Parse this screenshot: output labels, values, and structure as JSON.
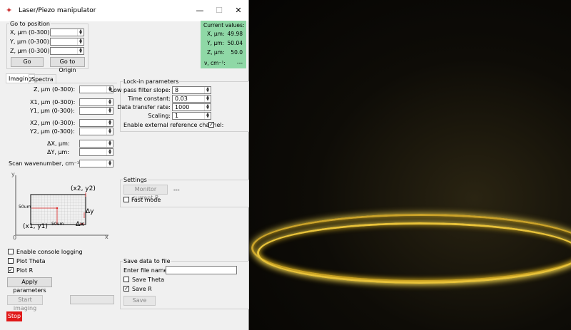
{
  "window": {
    "title": "Laser/Piezo manipulator",
    "min": "—",
    "max": "☐",
    "close": "✕"
  },
  "goto": {
    "title": "Go to position",
    "x_label": "X, µm (0-300):",
    "y_label": "Y, µm (0-300):",
    "z_label": "Z, µm (0-300):",
    "go": "Go",
    "origin": "Go to Origin"
  },
  "current": {
    "title": "Current values:",
    "x_label": "X, µm:",
    "x_val": "49.98",
    "y_label": "Y, µm:",
    "y_val": "50.04",
    "z_label": "Z, µm:",
    "z_val": "50.0",
    "v_label": "ν, cm⁻¹:",
    "v_val": "---"
  },
  "tabs": {
    "imaging": "Imaging",
    "spectra": "Spectra"
  },
  "imaging": {
    "z": "Z, µm (0-300):",
    "x1": "X1, µm (0-300):",
    "y1": "Y1, µm (0-300):",
    "x2": "X2, µm (0-300):",
    "y2": "Y2, µm (0-300):",
    "dx": "ΔX, µm:",
    "dy": "ΔY, µm:",
    "scan": "Scan wavenumber, cm⁻¹:"
  },
  "diagram": {
    "y": "y",
    "x": "x",
    "zero": "0",
    "p2": "(x2, y2)",
    "p1": "(x1, y1)",
    "dy": "Δy",
    "dx": "Δx",
    "h50": "50um",
    "w50": "50um"
  },
  "options": {
    "console": "Enable console logging",
    "theta": "Plot Theta",
    "r": "Plot R",
    "apply": "Apply parameters",
    "start": "Start imaging"
  },
  "lockin": {
    "title": "Lock-in parameters",
    "lpf": "Low pass filter slope:",
    "lpf_val": "8",
    "tc": "Time constant:",
    "tc_val": "0.03",
    "rate": "Data transfer rate:",
    "rate_val": "1000",
    "scaling": "Scaling:",
    "scaling_val": "1",
    "ext": "Enable external reference channel:"
  },
  "settings": {
    "title": "Settings",
    "monitor": "Monitor current R",
    "monitor_val": "---",
    "fast": "Fast mode"
  },
  "save": {
    "title": "Save data to file",
    "file_label": "Enter file name:",
    "theta": "Save Theta",
    "r": "Save R",
    "button": "Save"
  },
  "stop": "Stop"
}
